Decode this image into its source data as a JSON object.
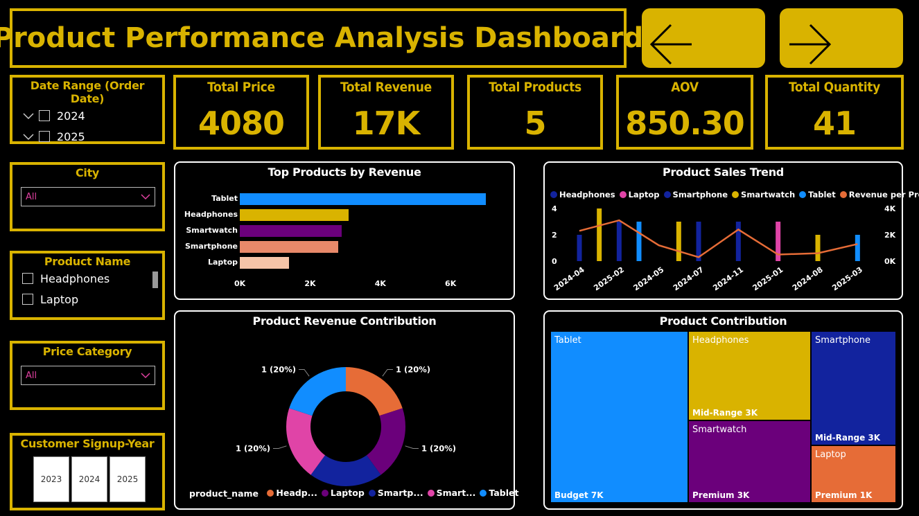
{
  "header": {
    "title": "Product Performance Analysis Dashboard"
  },
  "nav": {
    "back_icon": "arrow-left-icon",
    "forward_icon": "arrow-right-icon"
  },
  "kpis": [
    {
      "label": "Total Price",
      "value": "4080"
    },
    {
      "label": "Total Revenue",
      "value": "17K"
    },
    {
      "label": "Total Products",
      "value": "5"
    },
    {
      "label": "AOV",
      "value": "850.30"
    },
    {
      "label": "Total Quantity",
      "value": "41"
    }
  ],
  "slicers": {
    "date_range": {
      "title": "Date Range (Order Date)",
      "items": [
        "2024",
        "2025"
      ]
    },
    "city": {
      "title": "City",
      "selected": "All"
    },
    "product_name": {
      "title": "Product Name",
      "items": [
        "Headphones",
        "Laptop"
      ]
    },
    "price_category": {
      "title": "Price Category",
      "selected": "All"
    },
    "signup_year": {
      "title": "Customer Signup-Year",
      "items": [
        "2023",
        "2024",
        "2025"
      ]
    }
  },
  "colors": {
    "gold": "#d9b300",
    "blue": "#118dff",
    "navy": "#12239e",
    "orange": "#e66c37",
    "purple": "#6b007b",
    "pink": "#e044a7",
    "salmon": "#e8896a",
    "peach": "#f5c4a8"
  },
  "chart_data": [
    {
      "type": "bar",
      "title": "Top Products by Revenue",
      "orientation": "horizontal",
      "categories": [
        "Tablet",
        "Headphones",
        "Smartwatch",
        "Smartphone",
        "Laptop"
      ],
      "values": [
        7000,
        3100,
        2900,
        2800,
        1400
      ],
      "colors": [
        "#118dff",
        "#d9b300",
        "#6b007b",
        "#e8896a",
        "#f5c4a8"
      ],
      "xticks": [
        "0K",
        "2K",
        "4K",
        "6K"
      ],
      "xlim": [
        0,
        7400
      ]
    },
    {
      "type": "bar",
      "title": "Product Sales Trend",
      "legend": [
        "Headphones",
        "Laptop",
        "Smartphone",
        "Smartwatch",
        "Tablet",
        "Revenue per Product"
      ],
      "legend_colors": [
        "#12239e",
        "#e044a7",
        "#12239e",
        "#d9b300",
        "#118dff",
        "#e66c37"
      ],
      "categories": [
        "2024-04",
        "2025-02",
        "2024-05",
        "2024-07",
        "2024-11",
        "2025-01",
        "2024-08",
        "2025-03"
      ],
      "bars": [
        {
          "x": 0,
          "series": "Headphones",
          "value": 2
        },
        {
          "x": 0.5,
          "series": "Smartwatch",
          "value": 4
        },
        {
          "x": 1,
          "series": "Headphones",
          "value": 3
        },
        {
          "x": 1.5,
          "series": "Tablet",
          "value": 3
        },
        {
          "x": 2.5,
          "series": "Smartwatch",
          "value": 3
        },
        {
          "x": 3,
          "series": "Headphones",
          "value": 3
        },
        {
          "x": 4,
          "series": "Headphones",
          "value": 3
        },
        {
          "x": 5,
          "series": "Laptop",
          "value": 3
        },
        {
          "x": 6,
          "series": "Smartwatch",
          "value": 2
        },
        {
          "x": 7,
          "series": "Tablet",
          "value": 2
        }
      ],
      "line": {
        "name": "Revenue per Product",
        "points": [
          [
            0,
            2300
          ],
          [
            1,
            3100
          ],
          [
            2,
            1200
          ],
          [
            3,
            300
          ],
          [
            4,
            2400
          ],
          [
            5,
            500
          ],
          [
            6,
            600
          ],
          [
            7,
            1300
          ]
        ]
      },
      "ylim_left": [
        0,
        4
      ],
      "yticks_left": [
        "0",
        "2",
        "4"
      ],
      "ylim_right": [
        0,
        4000
      ],
      "yticks_right": [
        "0K",
        "2K",
        "4K"
      ]
    },
    {
      "type": "pie",
      "title": "Product Revenue Contribution",
      "legend_title": "product_name",
      "labels": [
        "Headphones",
        "Laptop",
        "Smartphone",
        "Smartwatch",
        "Tablet"
      ],
      "legend_labels": [
        "Headp...",
        "Laptop",
        "Smartp...",
        "Smart...",
        "Tablet"
      ],
      "values": [
        1,
        1,
        1,
        1,
        1
      ],
      "data_labels": [
        "1 (20%)",
        "1 (20%)",
        "1 (20%)",
        "1 (20%)",
        "1 (20%)"
      ],
      "colors": [
        "#e66c37",
        "#6b007b",
        "#12239e",
        "#e044a7",
        "#118dff"
      ]
    },
    {
      "type": "treemap",
      "title": "Product Contribution",
      "tiles": [
        {
          "name": "Tablet",
          "category": "Budget 7K",
          "color": "#118dff"
        },
        {
          "name": "Headphones",
          "category": "Mid-Range 3K",
          "color": "#d9b300"
        },
        {
          "name": "Smartwatch",
          "category": "Premium 3K",
          "color": "#6b007b"
        },
        {
          "name": "Smartphone",
          "category": "Mid-Range 3K",
          "color": "#12239e"
        },
        {
          "name": "Laptop",
          "category": "Premium 1K",
          "color": "#e66c37"
        }
      ]
    }
  ]
}
